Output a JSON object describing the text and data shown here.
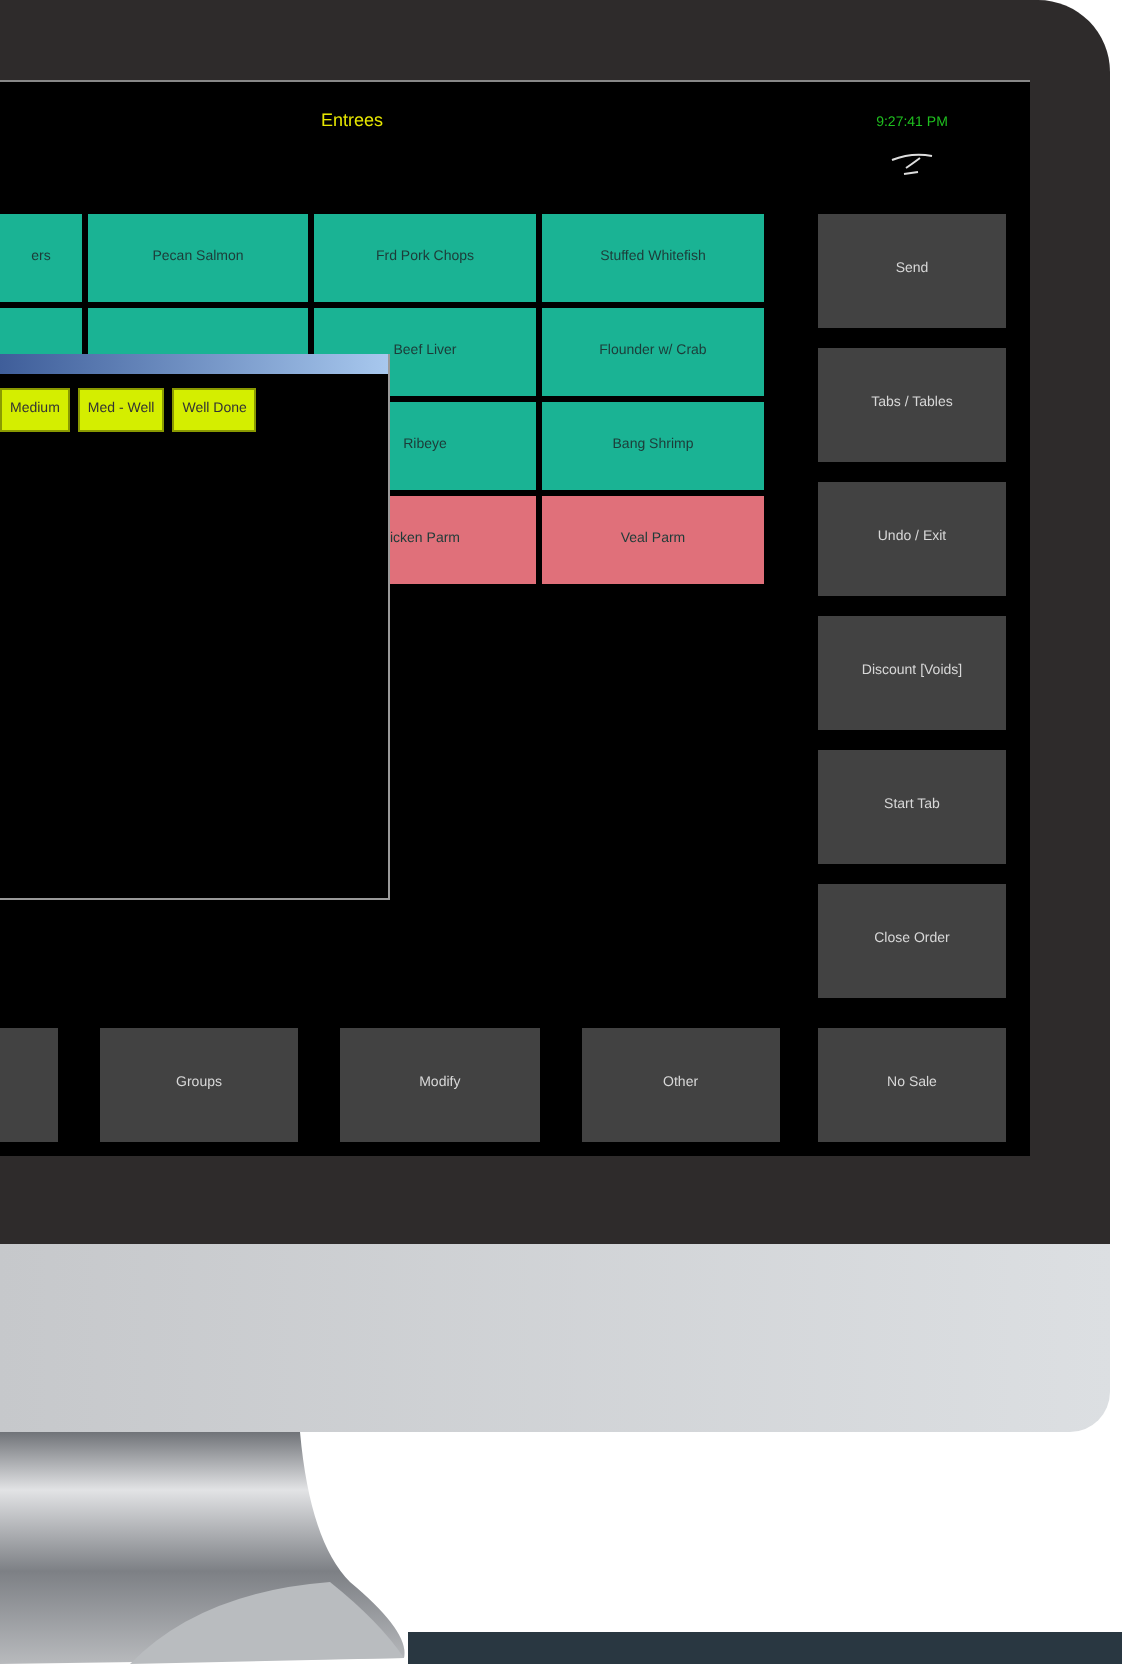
{
  "screen_title": "Entrees",
  "clock": "9:27:41 PM",
  "menu_rows": [
    {
      "items": [
        {
          "label": "ers",
          "color": "#1ab394"
        },
        {
          "label": "Pecan Salmon",
          "color": "#1ab394"
        },
        {
          "label": "Frd Pork Chops",
          "color": "#1ab394"
        },
        {
          "label": "Stuffed Whitefish",
          "color": "#1ab394"
        }
      ]
    },
    {
      "items": [
        {
          "color": "#1ab394"
        },
        {
          "color": "#1ab394"
        },
        {
          "label": "Beef Liver",
          "color": "#1ab394"
        },
        {
          "label": "Flounder w/ Crab",
          "color": "#1ab394"
        }
      ]
    },
    {
      "items": [
        {
          "label": "Ribeye",
          "color": "#1ab394"
        },
        {
          "label": "Bang Shrimp",
          "color": "#1ab394"
        }
      ]
    },
    {
      "items": [
        {
          "label": "icken Parm",
          "color": "#e0707a"
        },
        {
          "label": "Veal Parm",
          "color": "#e0707a"
        }
      ]
    }
  ],
  "modifier_dialog": {
    "options": [
      "Medium",
      "Med - Well",
      "Well Done"
    ]
  },
  "side_buttons": [
    "Send",
    "Tabs / Tables",
    "Undo / Exit",
    "Discount  [Voids]",
    "Start Tab",
    "Close Order"
  ],
  "bottom_buttons": [
    "Groups",
    "Modify",
    "Other",
    "No Sale"
  ]
}
